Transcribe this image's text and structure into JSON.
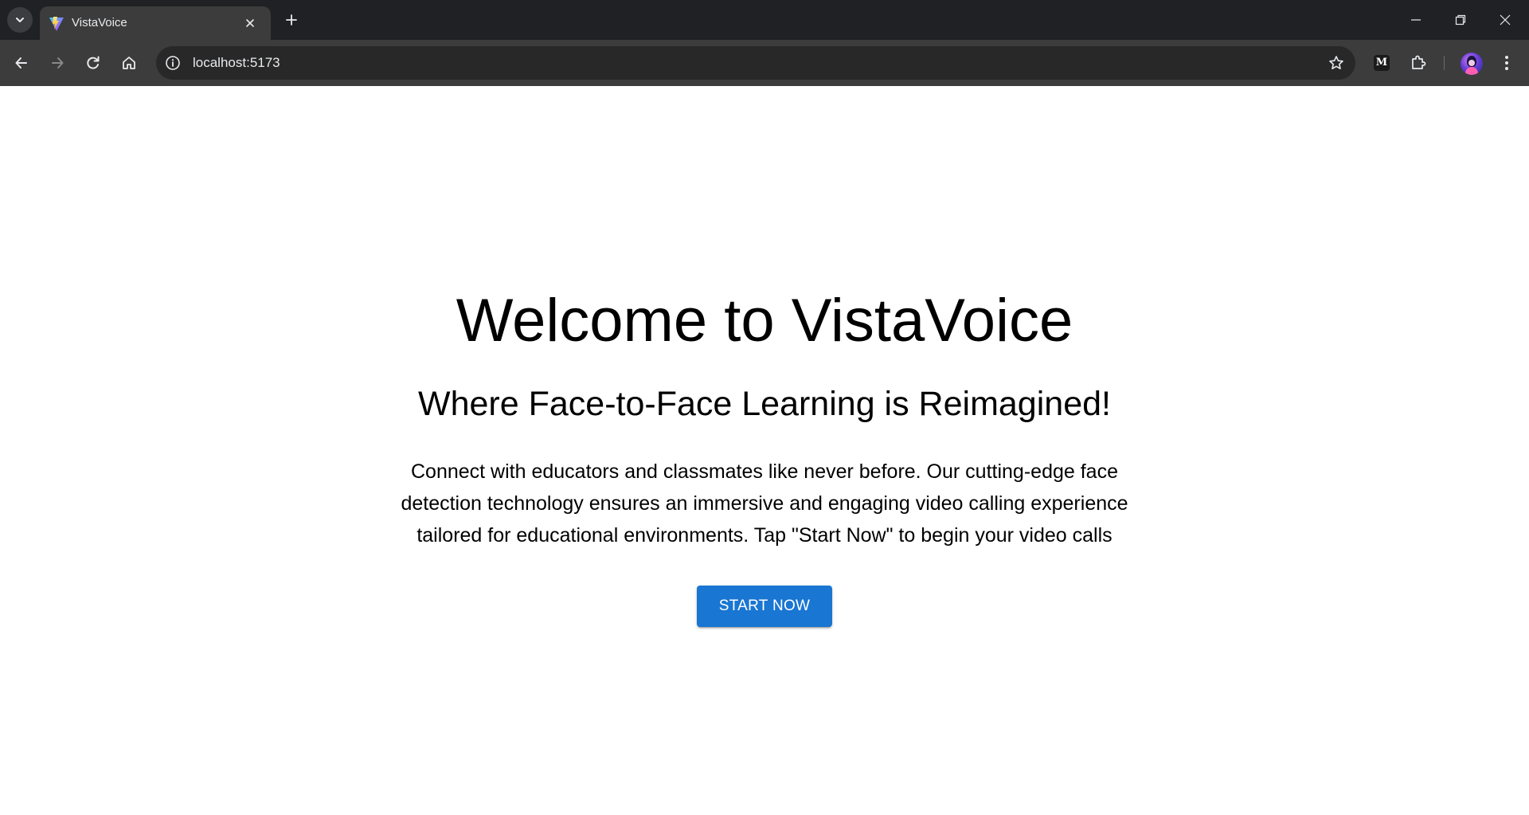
{
  "browser": {
    "tab": {
      "title": "VistaVoice"
    },
    "address_bar": {
      "url": "localhost:5173"
    },
    "extensions": {
      "medium_label": "M"
    },
    "colors": {
      "chrome_dark": "#202124",
      "toolbar": "#3c3c3c",
      "omnibox": "#282828"
    }
  },
  "hero": {
    "title": "Welcome to VistaVoice",
    "subtitle": "Where Face-to-Face Learning is Reimagined!",
    "description": "Connect with educators and classmates like never before. Our cutting-edge face detection technology ensures an immersive and engaging video calling experience tailored for educational environments. Tap \"Start Now\" to begin your video calls",
    "cta_label": "START NOW"
  },
  "colors": {
    "primary": "#1976d2",
    "text": "#000000",
    "background": "#ffffff"
  }
}
